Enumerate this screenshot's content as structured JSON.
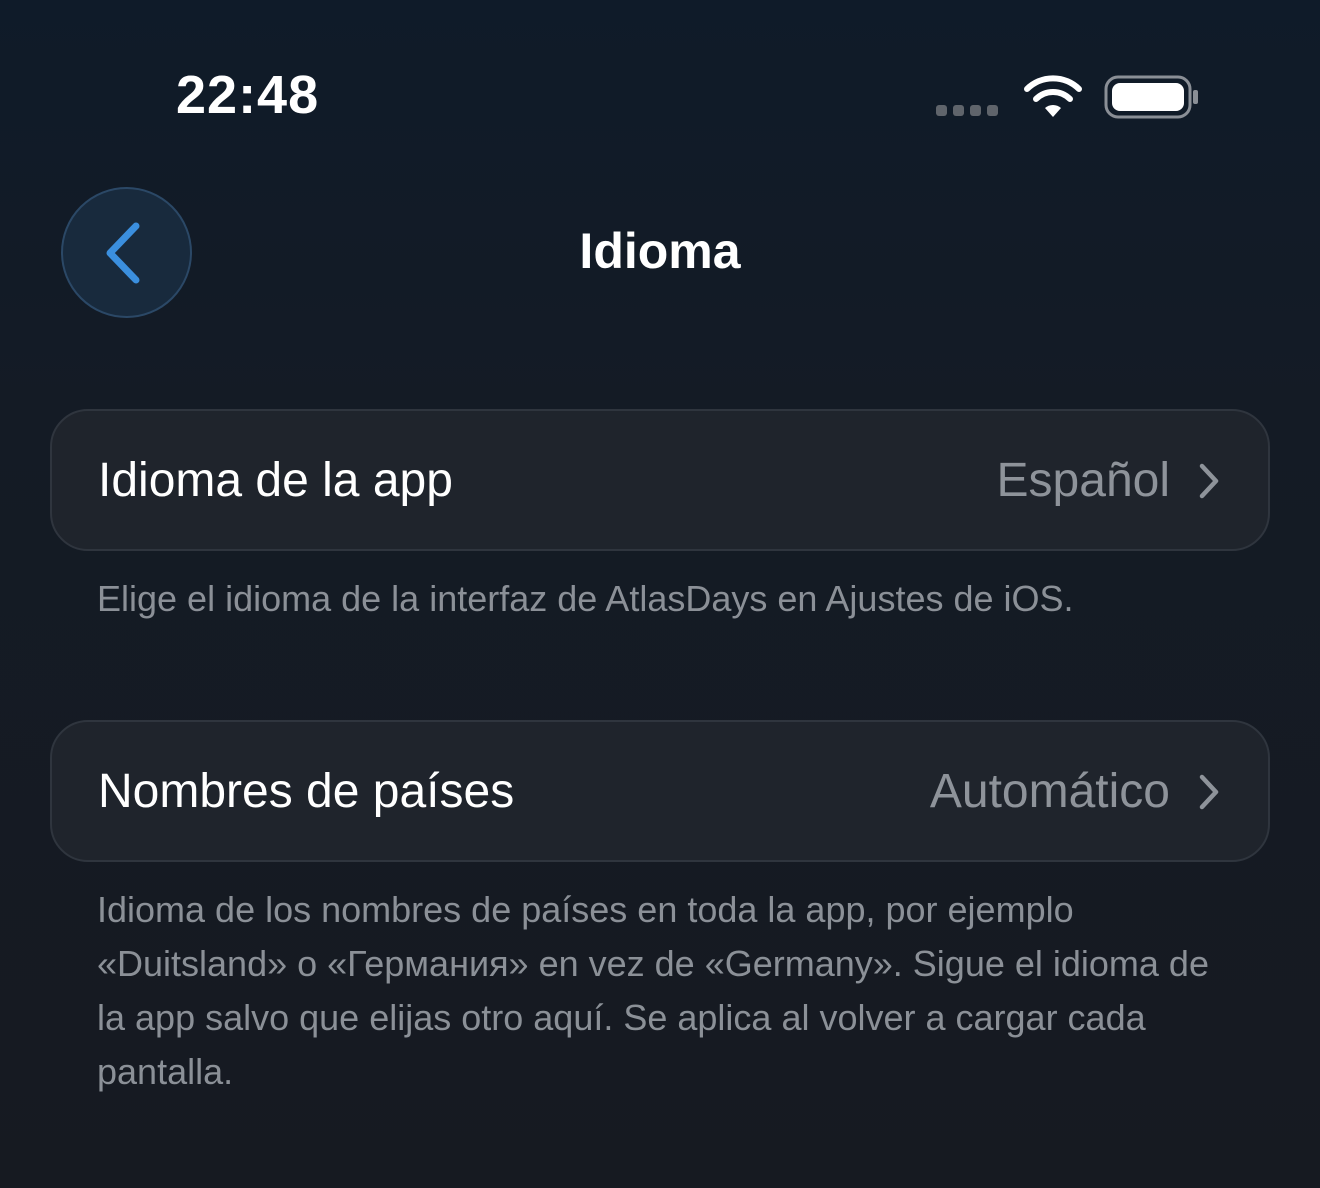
{
  "status_bar": {
    "time": "22:48",
    "icons": [
      "signal-dots-icon",
      "wifi-icon",
      "battery-icon"
    ]
  },
  "nav": {
    "back_icon": "chevron-left-icon",
    "title": "Idioma"
  },
  "rows": [
    {
      "label": "Idioma de la app",
      "value": "Español",
      "footer": "Elige el idioma de la interfaz de AtlasDays en Ajustes de iOS."
    },
    {
      "label": "Nombres de países",
      "value": "Automático",
      "footer": "Idioma de los nombres de países en toda la app, por ejemplo «Duitsland» o «Германия» en vez de «Germany». Sigue el idioma de la app salvo que elijas otro aquí. Se aplica al volver a cargar cada pantalla."
    }
  ],
  "colors": {
    "accent": "#3b8fde",
    "background": "#141b25",
    "row_background": "#1f242c",
    "secondary_text": "#8e939a"
  }
}
